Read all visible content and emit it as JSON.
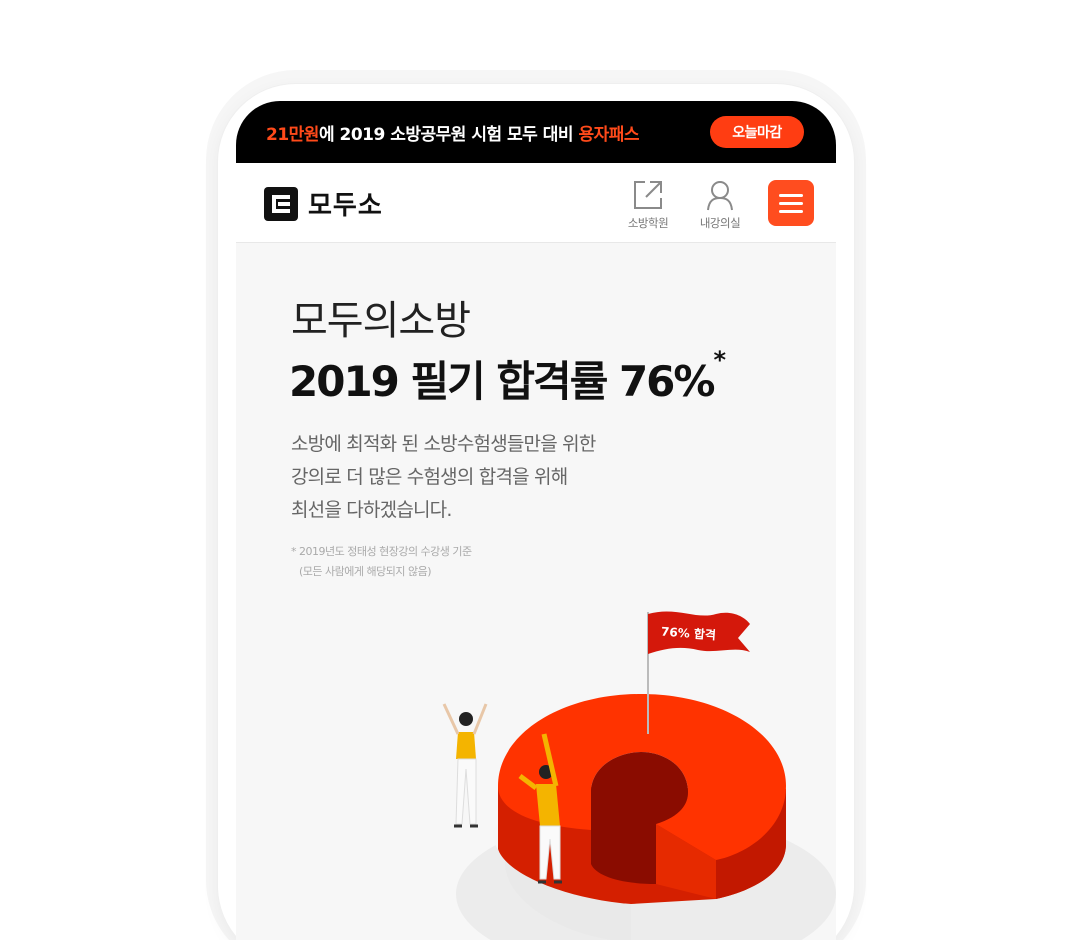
{
  "banner": {
    "price": "21만원",
    "text": "에 2019 소방공무원 시험 모두 대비 ",
    "pass": "용자패스",
    "button": "오늘마감"
  },
  "header": {
    "logo": "모두소",
    "academy_label": "소방학원",
    "lecture_label": "내강의실",
    "menu_icon": "hamburger-icon"
  },
  "hero": {
    "subtitle": "모두의소방",
    "title": "2019 필기 합격률 76%",
    "title_mark": "*",
    "desc_lines": [
      "소방에 최적화 된 소방수험생들만을 위한",
      "강의로 더 많은 수험생의 합격을 위해",
      "최선을 다하겠습니다."
    ],
    "note_lines": [
      "* 2019년도 정태성 현장강의 수강생 기준",
      "(모든 사람에게 해당되지 않음)"
    ],
    "flag_label": "76% 합격"
  },
  "colors": {
    "accent": "#ff4a1a",
    "banner_bg": "#000000",
    "donut_red": "#ff3300"
  },
  "chart_data": {
    "type": "pie",
    "categories": [
      "합격"
    ],
    "values": [
      76
    ]
  }
}
